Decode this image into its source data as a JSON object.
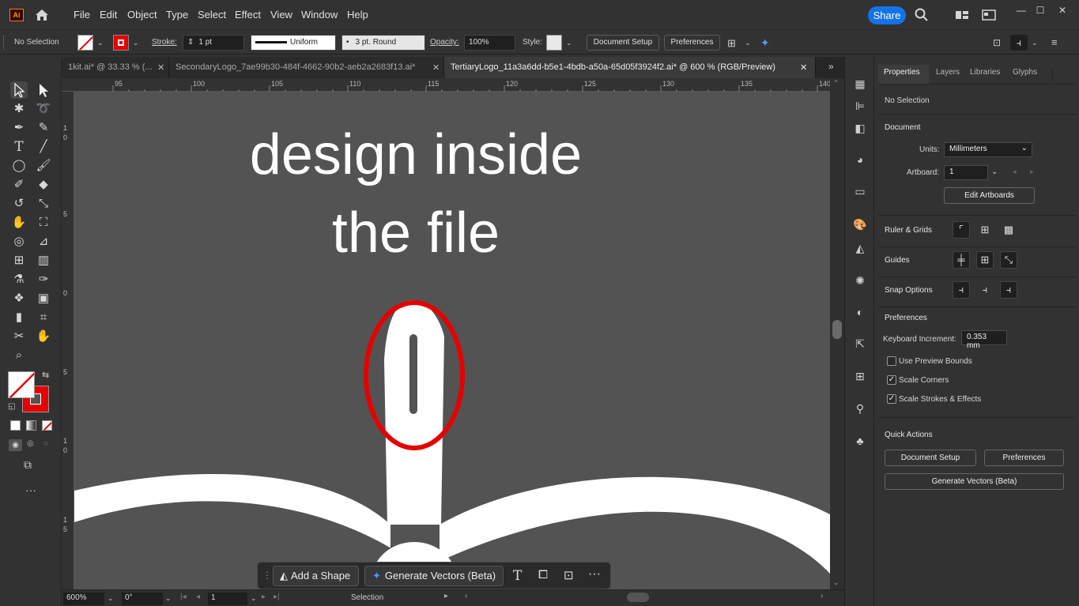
{
  "app": {
    "logo_text": "Ai"
  },
  "menu": [
    "File",
    "Edit",
    "Object",
    "Type",
    "Select",
    "Effect",
    "View",
    "Window",
    "Help"
  ],
  "share_label": "Share",
  "control_bar": {
    "selection_status": "No Selection",
    "stroke_label": "Stroke:",
    "stroke_value": "1 pt",
    "stroke_profile": "Uniform",
    "brush_label": "3 pt. Round",
    "opacity_label": "Opacity:",
    "opacity_value": "100%",
    "style_label": "Style:",
    "document_setup": "Document Setup",
    "preferences": "Preferences"
  },
  "tabs": [
    {
      "label": "1kit.ai* @ 33.33 % (..."
    },
    {
      "label": "SecondaryLogo_7ae99b30-484f-4662-90b2-aeb2a2683f13.ai*"
    },
    {
      "label": "TertiaryLogo_11a3a6dd-b5e1-4bdb-a50a-65d05f3924f2.ai* @ 600 % (RGB/Preview)"
    }
  ],
  "ruler_top": [
    "95",
    "100",
    "105",
    "110",
    "115",
    "120",
    "125",
    "130",
    "135",
    "140"
  ],
  "ruler_left": [
    "1 0",
    "5",
    "0",
    "5",
    "1 0",
    "1 5"
  ],
  "canvas": {
    "text_line1": "design inside",
    "text_line2": "the file"
  },
  "status": {
    "zoom": "600%",
    "rotation": "0°",
    "artboard": "1",
    "tool": "Selection"
  },
  "taskbar": {
    "add_shape": "Add a Shape",
    "generate_vectors": "Generate Vectors (Beta)"
  },
  "panel": {
    "tabs": [
      "Properties",
      "Layers",
      "Libraries",
      "Glyphs"
    ],
    "no_selection": "No Selection",
    "document_header": "Document",
    "units_label": "Units:",
    "units_value": "Millimeters",
    "artboard_label": "Artboard:",
    "artboard_value": "1",
    "edit_artboards": "Edit Artboards",
    "ruler_grids": "Ruler & Grids",
    "guides": "Guides",
    "snap_options": "Snap Options",
    "preferences_header": "Preferences",
    "keyboard_increment_label": "Keyboard Increment:",
    "keyboard_increment_value": "0.353 mm",
    "use_preview_bounds": "Use Preview Bounds",
    "scale_corners": "Scale Corners",
    "scale_strokes": "Scale Strokes & Effects",
    "quick_actions": "Quick Actions",
    "document_setup": "Document Setup",
    "preferences": "Preferences",
    "generate_vectors": "Generate Vectors (Beta)"
  },
  "colors": {
    "accent": "#1473e6",
    "highlight_red": "#e60000",
    "canvas": "#535353"
  }
}
